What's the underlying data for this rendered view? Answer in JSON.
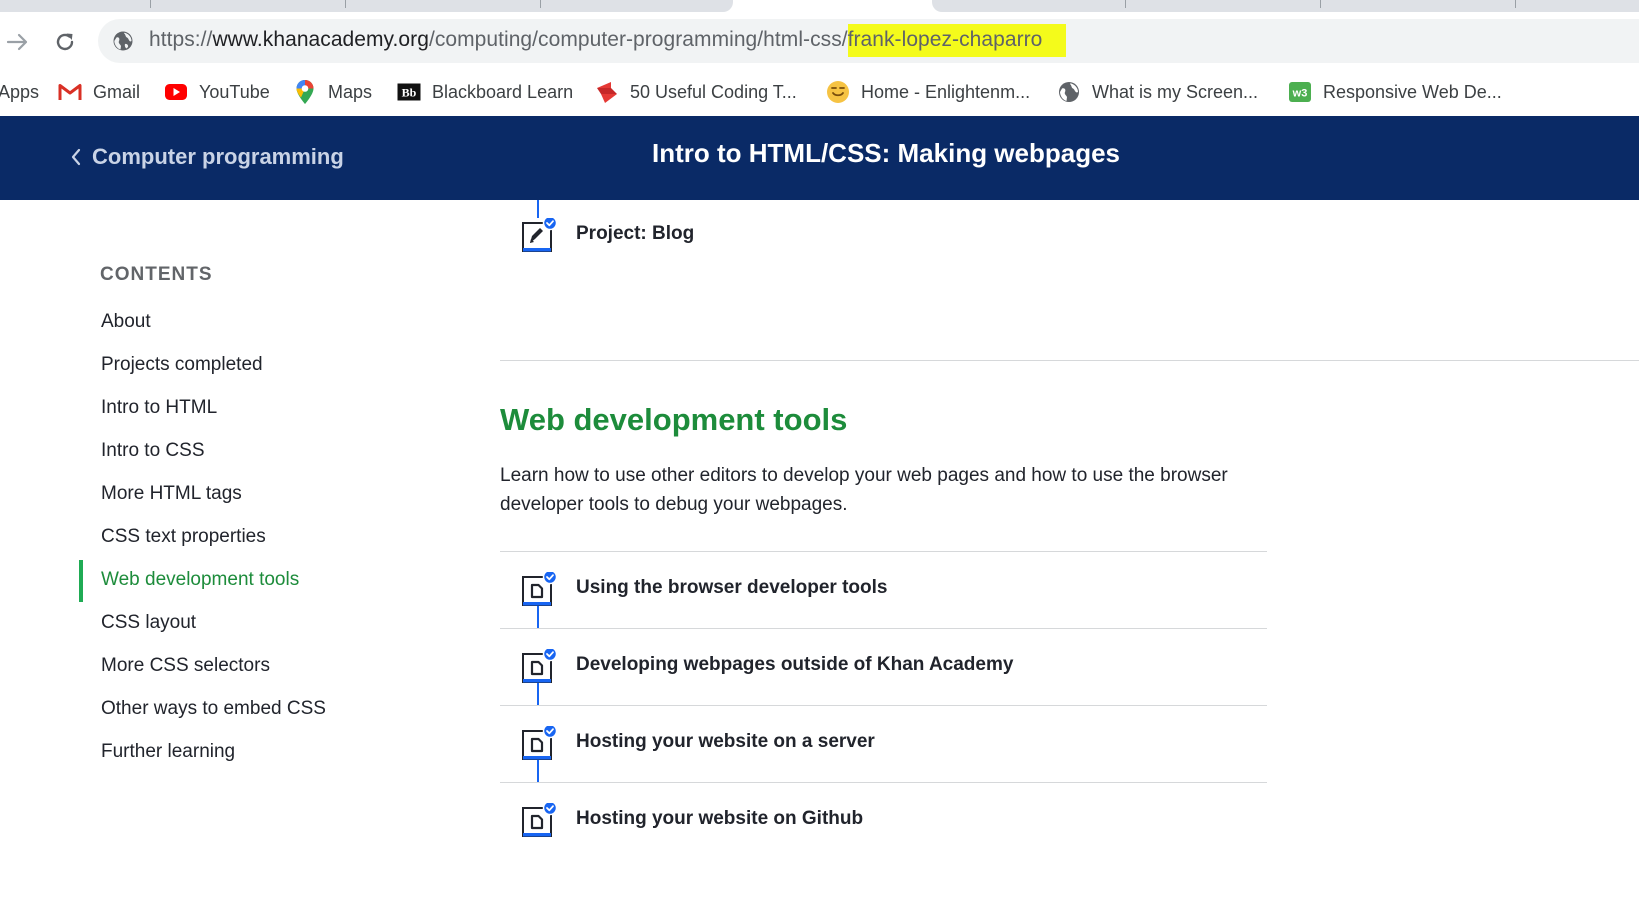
{
  "browser": {
    "url_scheme": "https://",
    "url_host": "www.khanacademy.org",
    "url_path": "/computing/computer-programming/html-css/",
    "url_highlight": "frank-lopez-chaparro",
    "icons": {
      "forward": "arrow-forward-icon",
      "reload": "reload-icon",
      "site_info": "globe-icon"
    }
  },
  "bookmarks": [
    {
      "label": "Apps",
      "icon": "apps-icon"
    },
    {
      "label": "Gmail",
      "icon": "gmail-icon"
    },
    {
      "label": "YouTube",
      "icon": "youtube-icon"
    },
    {
      "label": "Maps",
      "icon": "maps-icon"
    },
    {
      "label": "Blackboard Learn",
      "icon": "blackboard-icon"
    },
    {
      "label": "50 Useful Coding T...",
      "icon": "coding-icon"
    },
    {
      "label": "Home - Enlightenm...",
      "icon": "smiley-icon"
    },
    {
      "label": "What is my Screen...",
      "icon": "globe-icon"
    },
    {
      "label": "Responsive Web De...",
      "icon": "w3-icon"
    }
  ],
  "header": {
    "back_label": "Computer programming",
    "title": "Intro to HTML/CSS: Making webpages"
  },
  "sidebar": {
    "heading": "CONTENTS",
    "items": [
      {
        "label": "About"
      },
      {
        "label": "Projects completed"
      },
      {
        "label": "Intro to HTML"
      },
      {
        "label": "Intro to CSS"
      },
      {
        "label": "More HTML tags"
      },
      {
        "label": "CSS text properties"
      },
      {
        "label": "Web development tools",
        "active": true
      },
      {
        "label": "CSS layout"
      },
      {
        "label": "More CSS selectors"
      },
      {
        "label": "Other ways to embed CSS"
      },
      {
        "label": "Further learning"
      }
    ]
  },
  "main": {
    "project": {
      "label": "Project: Blog",
      "icon": "project-rocket-icon",
      "completed": true
    },
    "section": {
      "title": "Web development tools",
      "description": "Learn how to use other editors to develop your web pages and how to use the browser developer tools to debug your webpages."
    },
    "lessons": [
      {
        "label": "Using the browser developer tools",
        "icon": "article-icon",
        "completed": true
      },
      {
        "label": "Developing webpages outside of Khan Academy",
        "icon": "article-icon",
        "completed": true
      },
      {
        "label": "Hosting your website on a server",
        "icon": "article-icon",
        "completed": true
      },
      {
        "label": "Hosting your website on Github",
        "icon": "article-icon",
        "completed": true
      }
    ]
  },
  "colors": {
    "header_bg": "#0a2a66",
    "section_green": "#1d8c3b",
    "progress_blue": "#1865f2",
    "url_highlight": "#f4fb1b"
  }
}
